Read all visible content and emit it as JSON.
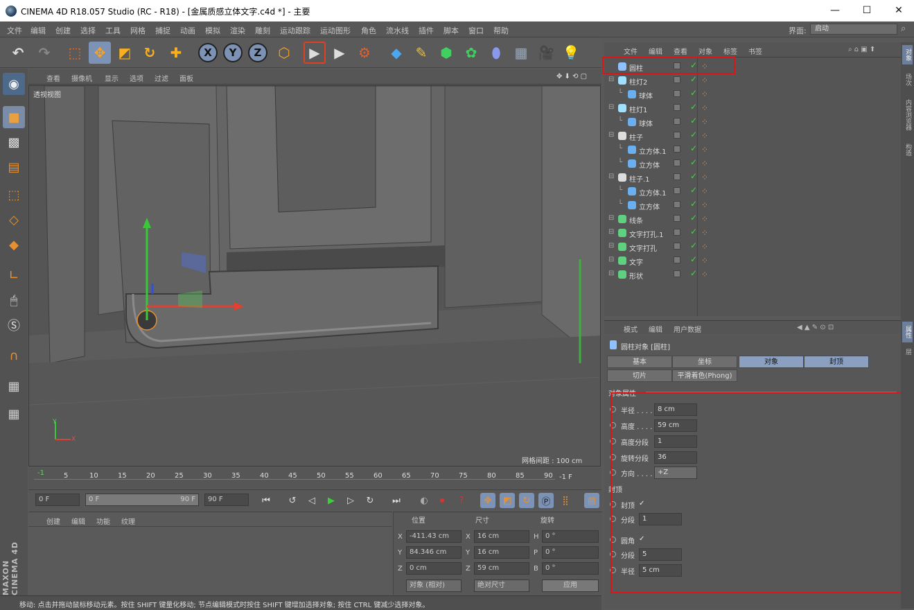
{
  "window": {
    "title": "CINEMA 4D R18.057 Studio (RC - R18) - [金属质感立体文字.c4d *] - 主要",
    "min": "—",
    "max": "☐",
    "close": "✕"
  },
  "menu": [
    "文件",
    "编辑",
    "创建",
    "选择",
    "工具",
    "网格",
    "捕捉",
    "动画",
    "模拟",
    "渲染",
    "雕刻",
    "运动跟踪",
    "运动图形",
    "角色",
    "流水线",
    "插件",
    "脚本",
    "窗口",
    "帮助"
  ],
  "layout": {
    "label": "界面:",
    "value": "启动"
  },
  "viewport": {
    "menu": [
      "查看",
      "摄像机",
      "显示",
      "选项",
      "过滤",
      "面板"
    ],
    "label": "透视视图",
    "grid": "网格间距 : 100 cm",
    "axis_y": "Y",
    "axis_x": "X"
  },
  "timeline": {
    "ticks": [
      "-1",
      "5",
      "10",
      "15",
      "20",
      "25",
      "30",
      "35",
      "40",
      "45",
      "50",
      "55",
      "60",
      "65",
      "70",
      "75",
      "80",
      "85",
      "90"
    ],
    "end": "-1 F",
    "start_field": "0 F",
    "range_start": "0 F",
    "range_end": "90 F",
    "end_field": "90 F"
  },
  "material": {
    "menu": [
      "创建",
      "编辑",
      "功能",
      "纹理"
    ]
  },
  "coords": {
    "headers": [
      "位置",
      "尺寸",
      "旋转"
    ],
    "rows": [
      {
        "a": "X",
        "pos": "-411.43 cm",
        "b": "X",
        "size": "16 cm",
        "c": "H",
        "rot": "0 °"
      },
      {
        "a": "Y",
        "pos": "84.346 cm",
        "b": "Y",
        "size": "16 cm",
        "c": "P",
        "rot": "0 °"
      },
      {
        "a": "Z",
        "pos": "0 cm",
        "b": "Z",
        "size": "59 cm",
        "c": "B",
        "rot": "0 °"
      }
    ],
    "mode1": "对象 (相对)",
    "mode2": "绝对尺寸",
    "apply": "应用"
  },
  "objects": {
    "menu": [
      "文件",
      "编辑",
      "查看",
      "对象",
      "标签",
      "书签"
    ],
    "rows": [
      {
        "name": "圆柱",
        "indent": 0,
        "color": "#8fc0ff"
      },
      {
        "name": "柱灯2",
        "indent": 0,
        "color": "#9fe0ff"
      },
      {
        "name": "球体",
        "indent": 1,
        "color": "#6ab0f0"
      },
      {
        "name": "柱灯1",
        "indent": 0,
        "color": "#9fe0ff"
      },
      {
        "name": "球体",
        "indent": 1,
        "color": "#6ab0f0"
      },
      {
        "name": "柱子",
        "indent": 0,
        "color": "#dddddd"
      },
      {
        "name": "立方体.1",
        "indent": 1,
        "color": "#6ab0f0"
      },
      {
        "name": "立方体",
        "indent": 1,
        "color": "#6ab0f0"
      },
      {
        "name": "柱子.1",
        "indent": 0,
        "color": "#dddddd"
      },
      {
        "name": "立方体.1",
        "indent": 1,
        "color": "#6ab0f0"
      },
      {
        "name": "立方体",
        "indent": 1,
        "color": "#6ab0f0"
      },
      {
        "name": "线条",
        "indent": 0,
        "color": "#5fd07f"
      },
      {
        "name": "文字打孔.1",
        "indent": 0,
        "color": "#5fd07f"
      },
      {
        "name": "文字打孔",
        "indent": 0,
        "color": "#5fd07f"
      },
      {
        "name": "文字",
        "indent": 0,
        "color": "#5fd07f"
      },
      {
        "name": "形状",
        "indent": 0,
        "color": "#5fd07f"
      }
    ]
  },
  "attributes": {
    "menu": [
      "模式",
      "编辑",
      "用户数据"
    ],
    "object_title": "圆柱对象 [圆柱]",
    "tabs_row1": [
      "基本",
      "坐标",
      "对象",
      "封顶"
    ],
    "tabs_row2": [
      "切片",
      "平滑着色(Phong)"
    ],
    "section_obj": "对象属性",
    "props": [
      {
        "label": "半径 . . . .",
        "value": "8 cm"
      },
      {
        "label": "高度 . . . .",
        "value": "59 cm"
      },
      {
        "label": "高度分段",
        "value": "1"
      },
      {
        "label": "旋转分段",
        "value": "36"
      },
      {
        "label": "方向 . . . .",
        "value": "+Z"
      }
    ],
    "section_cap": "封顶",
    "cap_props": [
      {
        "label": "封顶",
        "value": "✓"
      },
      {
        "label": "分段",
        "value": "1"
      },
      {
        "label": "圆角",
        "value": "✓"
      },
      {
        "label": "分段",
        "value": "5"
      },
      {
        "label": "半径",
        "value": "5 cm"
      }
    ]
  },
  "right_tabs": [
    "对象",
    "场次",
    "内容浏览器",
    "构造"
  ],
  "right_tabs2": [
    "属性",
    "层"
  ],
  "brand": "MAXON CINEMA 4D",
  "status": "移动: 点击并拖动鼠标移动元素。按住 SHIFT 键量化移动; 节点编辑模式时按住 SHIFT 键增加选择对象; 按住 CTRL 键减少选择对象。"
}
